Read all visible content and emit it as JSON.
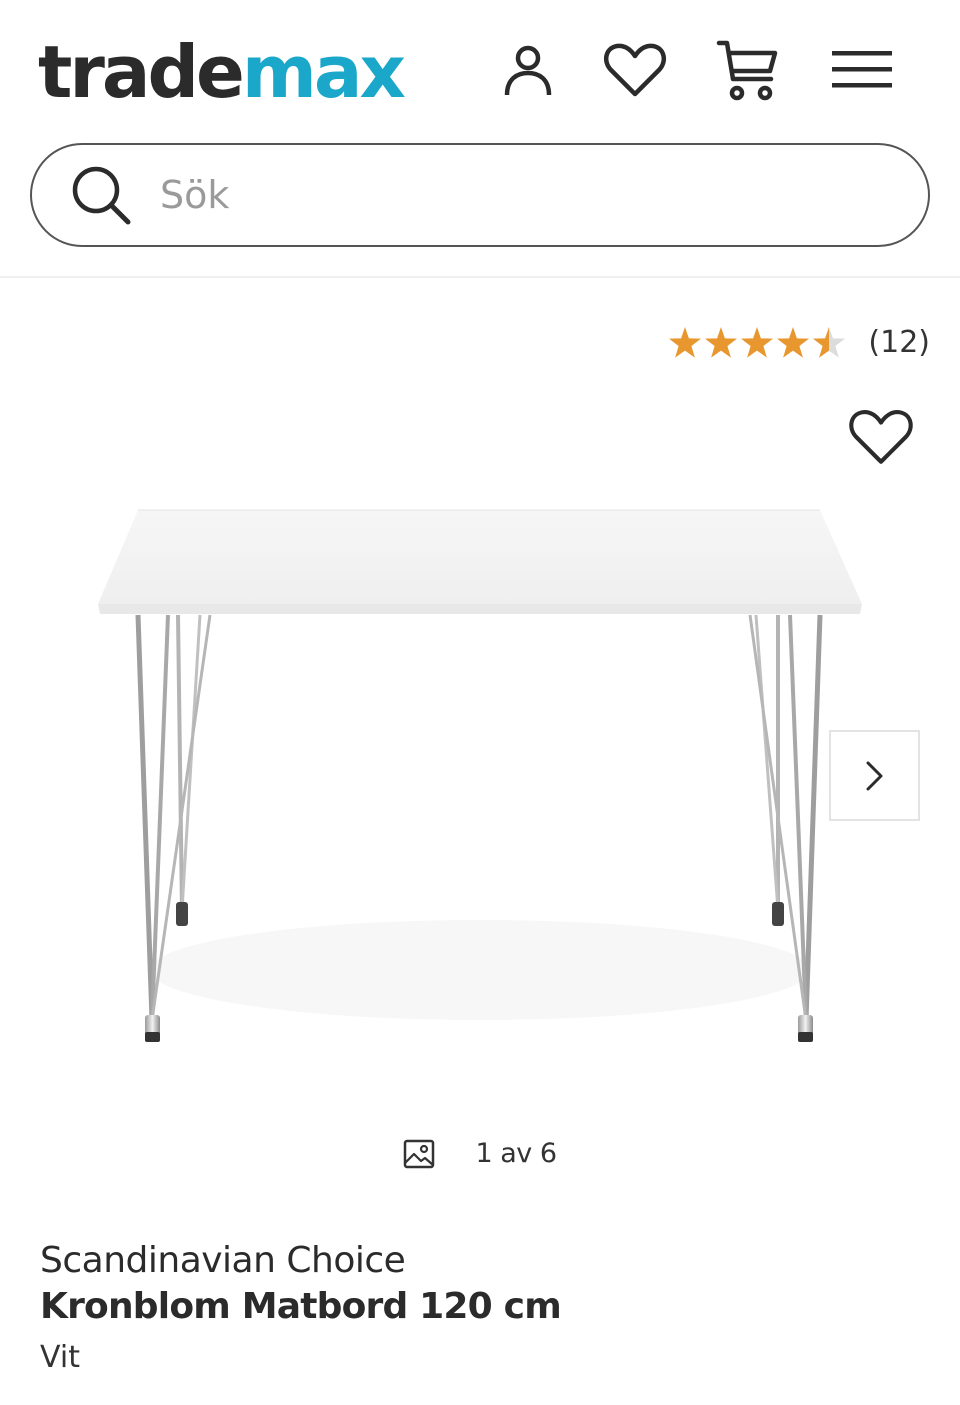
{
  "header": {
    "logo_part1": "trade",
    "logo_part2": "max",
    "logo_color_dark": "#2b2b2b",
    "logo_color_accent": "#1aa7c9",
    "icons": [
      "user-icon",
      "heart-icon",
      "cart-icon",
      "menu-icon"
    ]
  },
  "search": {
    "placeholder": "Sök",
    "value": ""
  },
  "product": {
    "rating_value": 4.5,
    "rating_max": 5,
    "star_color": "#e8962e",
    "review_count": "(12)",
    "gallery_counter": "1 av 6",
    "brand": "Scandinavian Choice",
    "name": "Kronblom Matbord 120 cm",
    "variant": "Vit"
  }
}
